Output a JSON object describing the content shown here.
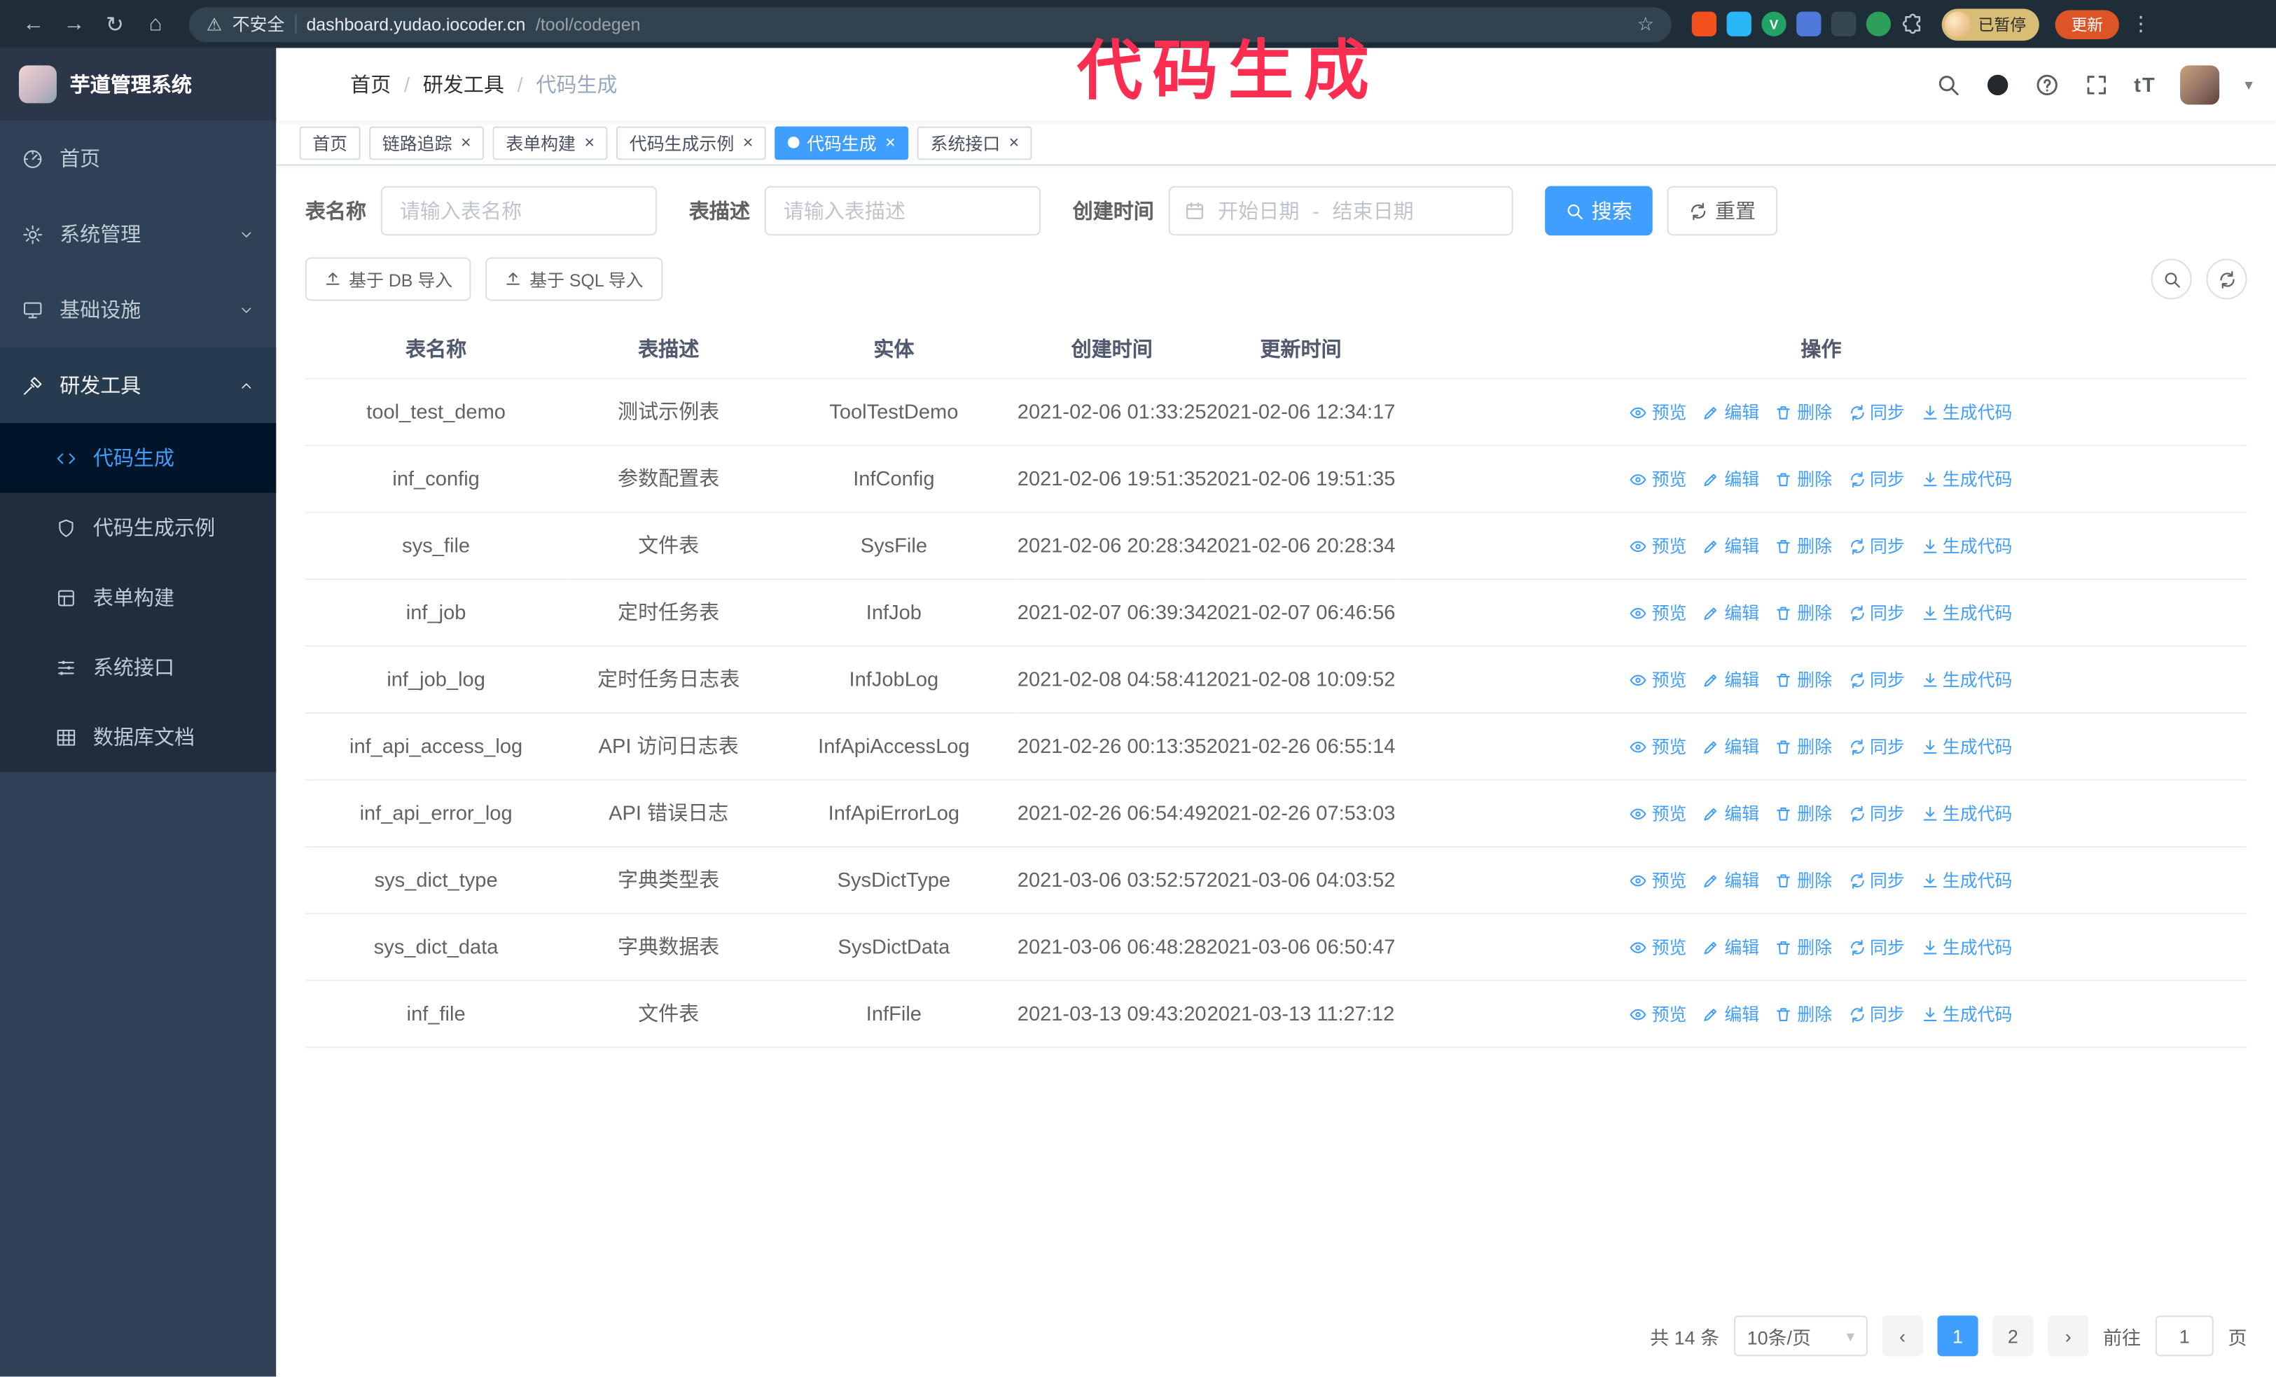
{
  "annotation": "代码生成",
  "browser": {
    "security_label": "不安全",
    "url_host": "dashboard.yudao.iocoder.cn",
    "url_path": "/tool/codegen",
    "profile_badge": "已暂停",
    "update_label": "更新"
  },
  "icons": {
    "back": "←",
    "forward": "→",
    "reload": "↻",
    "home": "⌂",
    "warning": "⚠",
    "star": "☆",
    "kebab": "⋮",
    "caret": "▾",
    "prev": "‹",
    "next": "›",
    "close": "×",
    "tt": "tT",
    "slash": "/"
  },
  "sidebar": {
    "logo_title": "芋道管理系统",
    "items": [
      {
        "label": "首页",
        "icon": "dashboard-icon"
      },
      {
        "label": "系统管理",
        "icon": "gear-icon"
      },
      {
        "label": "基础设施",
        "icon": "infra-icon"
      },
      {
        "label": "研发工具",
        "icon": "tools-icon",
        "expanded": true
      }
    ],
    "subitems": [
      {
        "label": "代码生成",
        "icon": "code-icon",
        "active": true
      },
      {
        "label": "代码生成示例",
        "icon": "shield-icon"
      },
      {
        "label": "表单构建",
        "icon": "form-icon"
      },
      {
        "label": "系统接口",
        "icon": "api-icon"
      },
      {
        "label": "数据库文档",
        "icon": "dbdoc-icon"
      }
    ]
  },
  "breadcrumb": [
    "首页",
    "研发工具",
    "代码生成"
  ],
  "tabs": [
    {
      "label": "首页"
    },
    {
      "label": "链路追踪"
    },
    {
      "label": "表单构建"
    },
    {
      "label": "代码生成示例"
    },
    {
      "label": "代码生成",
      "active": true
    },
    {
      "label": "系统接口"
    }
  ],
  "filters": {
    "table_name_label": "表名称",
    "table_name_placeholder": "请输入表名称",
    "table_desc_label": "表描述",
    "table_desc_placeholder": "请输入表描述",
    "create_time_label": "创建时间",
    "start_date_placeholder": "开始日期",
    "range_separator": "-",
    "end_date_placeholder": "结束日期",
    "search_button": "搜索",
    "reset_button": "重置"
  },
  "toolbar": {
    "import_db_button": "基于 DB 导入",
    "import_sql_button": "基于 SQL 导入"
  },
  "table": {
    "columns": [
      "表名称",
      "表描述",
      "实体",
      "创建时间",
      "更新时间",
      "操作"
    ],
    "actions": [
      {
        "key": "preview",
        "label": "预览"
      },
      {
        "key": "edit",
        "label": "编辑"
      },
      {
        "key": "delete",
        "label": "删除"
      },
      {
        "key": "sync",
        "label": "同步"
      },
      {
        "key": "generate",
        "label": "生成代码"
      }
    ],
    "rows": [
      {
        "name": "tool_test_demo",
        "desc": "测试示例表",
        "entity": "ToolTestDemo",
        "created": "2021-02-06 01:33:25",
        "updated": "2021-02-06 12:34:17"
      },
      {
        "name": "inf_config",
        "desc": "参数配置表",
        "entity": "InfConfig",
        "created": "2021-02-06 19:51:35",
        "updated": "2021-02-06 19:51:35"
      },
      {
        "name": "sys_file",
        "desc": "文件表",
        "entity": "SysFile",
        "created": "2021-02-06 20:28:34",
        "updated": "2021-02-06 20:28:34"
      },
      {
        "name": "inf_job",
        "desc": "定时任务表",
        "entity": "InfJob",
        "created": "2021-02-07 06:39:34",
        "updated": "2021-02-07 06:46:56"
      },
      {
        "name": "inf_job_log",
        "desc": "定时任务日志表",
        "entity": "InfJobLog",
        "created": "2021-02-08 04:58:41",
        "updated": "2021-02-08 10:09:52"
      },
      {
        "name": "inf_api_access_log",
        "desc": "API 访问日志表",
        "entity": "InfApiAccessLog",
        "created": "2021-02-26 00:13:35",
        "updated": "2021-02-26 06:55:14"
      },
      {
        "name": "inf_api_error_log",
        "desc": "API 错误日志",
        "entity": "InfApiErrorLog",
        "created": "2021-02-26 06:54:49",
        "updated": "2021-02-26 07:53:03"
      },
      {
        "name": "sys_dict_type",
        "desc": "字典类型表",
        "entity": "SysDictType",
        "created": "2021-03-06 03:52:57",
        "updated": "2021-03-06 04:03:52"
      },
      {
        "name": "sys_dict_data",
        "desc": "字典数据表",
        "entity": "SysDictData",
        "created": "2021-03-06 06:48:28",
        "updated": "2021-03-06 06:50:47"
      },
      {
        "name": "inf_file",
        "desc": "文件表",
        "entity": "InfFile",
        "created": "2021-03-13 09:43:20",
        "updated": "2021-03-13 11:27:12"
      }
    ]
  },
  "pagination": {
    "total_label": "共 14 条",
    "page_size_label": "10条/页",
    "pages": [
      "1",
      "2"
    ],
    "current_page": "1",
    "goto_label": "前往",
    "goto_value": "1",
    "unit_label": "页"
  },
  "colors": {
    "accent_blue": "#409eff",
    "annotation_pink": "#fb2e52",
    "sidebar_bg": "#304156",
    "submenu_bg": "#1f2d3d",
    "active_submenu_bg": "#001528",
    "chrome_bg": "#1f2d38",
    "update_button_orange": "#dd5427"
  }
}
